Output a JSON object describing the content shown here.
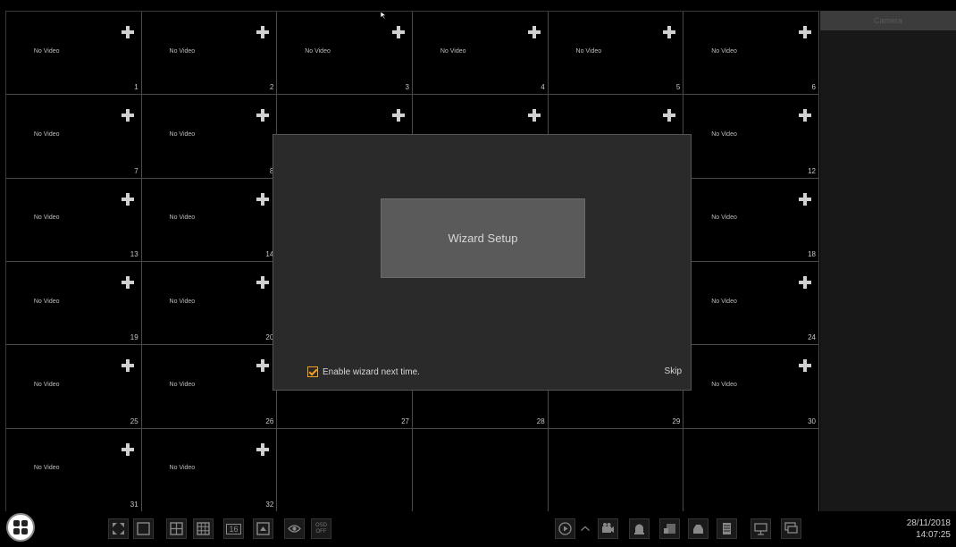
{
  "cell_label": "No Video",
  "grid": {
    "rows": [
      [
        {
          "num": "1",
          "novideo": true,
          "plus": true
        },
        {
          "num": "2",
          "novideo": true,
          "plus": true
        },
        {
          "num": "3",
          "novideo": true,
          "plus": true
        },
        {
          "num": "4",
          "novideo": true,
          "plus": true
        },
        {
          "num": "5",
          "novideo": true,
          "plus": true
        },
        {
          "num": "6",
          "novideo": true,
          "plus": true
        }
      ],
      [
        {
          "num": "7",
          "novideo": true,
          "plus": true
        },
        {
          "num": "8",
          "novideo": true,
          "plus": true
        },
        {
          "num": "",
          "novideo": false,
          "plus": true
        },
        {
          "num": "",
          "novideo": false,
          "plus": true
        },
        {
          "num": "",
          "novideo": false,
          "plus": true
        },
        {
          "num": "12",
          "novideo": true,
          "plus": true
        }
      ],
      [
        {
          "num": "13",
          "novideo": true,
          "plus": true
        },
        {
          "num": "14",
          "novideo": true,
          "plus": true
        },
        {
          "num": "",
          "novideo": false,
          "plus": false
        },
        {
          "num": "",
          "novideo": false,
          "plus": false
        },
        {
          "num": "",
          "novideo": false,
          "plus": false
        },
        {
          "num": "18",
          "novideo": true,
          "plus": true
        }
      ],
      [
        {
          "num": "19",
          "novideo": true,
          "plus": true
        },
        {
          "num": "20",
          "novideo": true,
          "plus": true
        },
        {
          "num": "",
          "novideo": false,
          "plus": false
        },
        {
          "num": "",
          "novideo": false,
          "plus": false
        },
        {
          "num": "",
          "novideo": false,
          "plus": false
        },
        {
          "num": "24",
          "novideo": true,
          "plus": true
        }
      ],
      [
        {
          "num": "25",
          "novideo": true,
          "plus": true
        },
        {
          "num": "26",
          "novideo": true,
          "plus": true
        },
        {
          "num": "27",
          "novideo": false,
          "plus": false
        },
        {
          "num": "28",
          "novideo": false,
          "plus": false
        },
        {
          "num": "29",
          "novideo": false,
          "plus": false
        },
        {
          "num": "30",
          "novideo": true,
          "plus": true
        }
      ],
      [
        {
          "num": "31",
          "novideo": true,
          "plus": true
        },
        {
          "num": "32",
          "novideo": true,
          "plus": true
        },
        {
          "num": "",
          "novideo": false,
          "plus": false
        },
        {
          "num": "",
          "novideo": false,
          "plus": false
        },
        {
          "num": "",
          "novideo": false,
          "plus": false
        },
        {
          "num": "",
          "novideo": false,
          "plus": false
        }
      ]
    ]
  },
  "sidebar": {
    "tab_label": "Camera"
  },
  "dialog": {
    "wizard_button": "Wizard Setup",
    "enable_label": "Enable wizard next time.",
    "enable_checked": true,
    "skip_label": "Skip"
  },
  "taskbar": {
    "osd_top": "OSD",
    "osd_bottom": "OFF",
    "layout_16": "16",
    "date": "28/11/2018",
    "time": "14:07:25"
  },
  "colors": {
    "accent": "#f0a020",
    "dialog_bg": "#2a2a2a",
    "button_bg": "#5a5a5a"
  }
}
